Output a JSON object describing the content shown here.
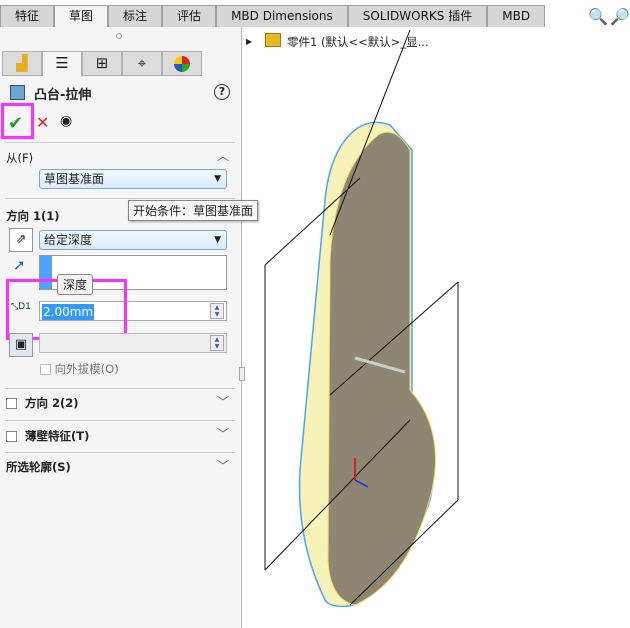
{
  "tabs": [
    "特征",
    "草图",
    "标注",
    "评估",
    "MBD Dimensions",
    "SOLIDWORKS 插件",
    "MBD"
  ],
  "active_tab": "草图",
  "panel": {
    "icon_tabs": [
      "feature-manager-icon",
      "property-manager-icon",
      "configuration-manager-icon",
      "dimxpert-icon",
      "display-manager-icon"
    ],
    "title": "凸台-拉伸",
    "help": "?",
    "ok": "✔",
    "cancel": "✕",
    "preview": "👁",
    "from": {
      "label": "从(F)",
      "value": "草图基准面"
    },
    "tooltip": "开始条件：草图基准面",
    "direction1": {
      "label": "方向 1(1)",
      "end_condition": "给定深度",
      "depth_tooltip": "深度",
      "depth": "2.00mm",
      "draft_label": "向外拔模(O)"
    },
    "direction2": {
      "label": "方向 2(2)"
    },
    "thin": {
      "label": "薄壁特征(T)"
    },
    "contours": {
      "label": "所选轮廓(S)"
    }
  },
  "tree": {
    "item": "零件1  (默认<<默认>_显..."
  },
  "colors": {
    "highlight": "#ff30ff",
    "selection": "#3399ff",
    "face": "#8e8672",
    "edge": "#4aa3ff"
  }
}
